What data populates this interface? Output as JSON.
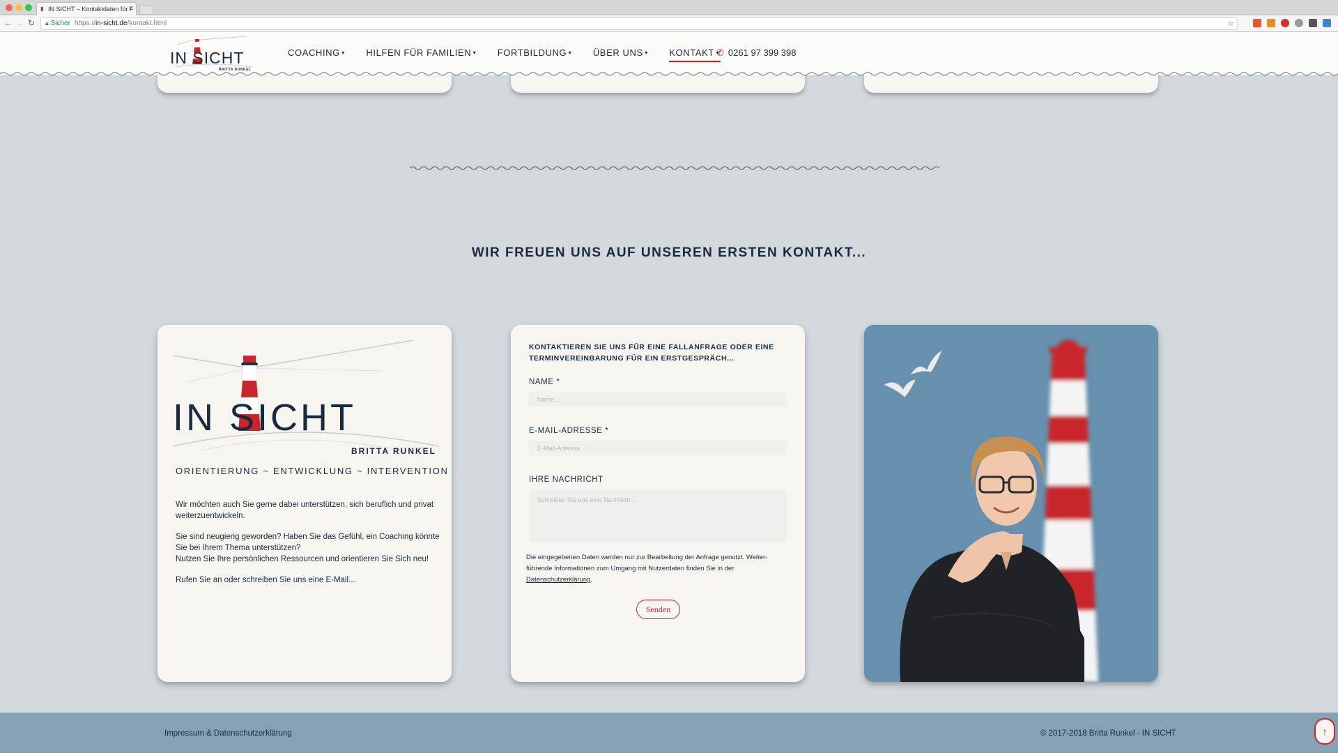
{
  "browser": {
    "tab_title": "IN SICHT – Kontaktdaten für F",
    "tab_close": "×",
    "secure_label": "Sicher",
    "url_scheme": "https://",
    "url_host": "in-sicht.de",
    "url_path": "/kontakt.html"
  },
  "header": {
    "logo_text": "IN SICHT",
    "logo_sub": "BRITTA RUNKEL",
    "nav": [
      {
        "label": "COACHING"
      },
      {
        "label": "HILFEN FÜR FAMILIEN"
      },
      {
        "label": "FORTBILDUNG"
      },
      {
        "label": "ÜBER UNS"
      },
      {
        "label": "KONTAKT"
      }
    ],
    "phone": "0261 97 399 398"
  },
  "section": {
    "title": "WIR FREUEN UNS AUF UNSEREN ERSTEN KONTAKT..."
  },
  "left_card": {
    "logo_text": "IN SICHT",
    "logo_sub": "BRITTA RUNKEL",
    "tagline": "ORIENTIERUNG ~ ENTWICKLUNG ~ INTERVENTION",
    "p1": "Wir möchten auch Sie gerne dabei unterstützen, sich beruflich und privat weiterzuentwickeln.",
    "p2a": "Sie sind neugierig geworden? Haben Sie das Gefühl, ein Coaching könnte Sie bei Ihrem Thema unterstützen?",
    "p2b": "Nutzen Sie Ihre persönlichen Ressourcen und orientieren Sie Sich neu!",
    "p3": "Rufen Sie an oder schreiben Sie uns eine E-Mail..."
  },
  "form": {
    "intro": "KONTAKTIEREN SIE UNS FÜR EINE FALLANFRAGE ODER EINE TERMINVEREINBARUNG FÜR EIN ERSTGESPRÄCH...",
    "name_label": "NAME *",
    "name_placeholder": "Name...",
    "email_label": "E-MAIL-ADRESSE *",
    "email_placeholder": "E-Mail-Adresse...",
    "message_label": "IHRE NACHRICHT",
    "message_placeholder": "Schreiben Sie uns eine Nachricht...",
    "privacy_text": "Die eingegebenen Daten werden nur zur Bearbeitung der Anfrage genutzt. Weiter-führende Informationen zum Umgang mit Nutzerdaten finden Sie in der",
    "privacy_link": "Datenschutzerklärung",
    "privacy_end": ".",
    "submit_label": "Senden"
  },
  "footer": {
    "left": "Impressum & Datenschutzerklärung",
    "right": "© 2017-2018 Britta Runkel - IN SICHT",
    "to_top": "↑"
  },
  "colors": {
    "accent": "#c8252c",
    "navy": "#1a2a3e",
    "page_bg": "#d2d8dc",
    "card_bg": "#f7f5f0",
    "footer_bg": "#85a2b4",
    "photo_bg": "#6690ad"
  },
  "icons": {
    "phone": "phone-icon",
    "lock": "lock-icon",
    "star": "star-icon",
    "to_top": "arrow-up-icon"
  }
}
